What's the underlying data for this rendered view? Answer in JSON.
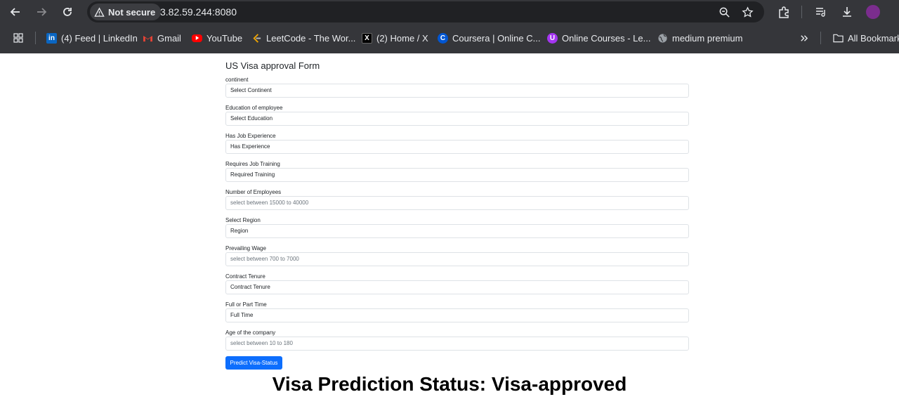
{
  "browser": {
    "security_label": "Not secure",
    "url": "3.82.59.244:8080",
    "colors": {
      "chrome_bg": "#35363a",
      "omnibox_bg": "#202124",
      "text": "#e8eaed"
    },
    "icons": [
      "back-icon",
      "forward-icon",
      "reload-icon",
      "warning-icon",
      "zoom-icon",
      "star-icon",
      "extensions-icon",
      "reading-list-icon",
      "download-icon",
      "apps-icon",
      "more-bookmarks-icon",
      "folder-icon"
    ]
  },
  "bookmarks": [
    {
      "label": "(4) Feed | LinkedIn",
      "icon": "linkedin-icon"
    },
    {
      "label": "Gmail",
      "icon": "gmail-icon"
    },
    {
      "label": "YouTube",
      "icon": "youtube-icon"
    },
    {
      "label": "LeetCode - The Wor...",
      "icon": "leetcode-icon"
    },
    {
      "label": "(2) Home / X",
      "icon": "x-icon"
    },
    {
      "label": "Coursera | Online C...",
      "icon": "coursera-icon"
    },
    {
      "label": "Online Courses - Le...",
      "icon": "udemy-icon"
    },
    {
      "label": "medium premium",
      "icon": "globe-icon"
    }
  ],
  "all_bookmarks_label": "All Bookmarks",
  "form": {
    "title": "US Visa approval Form",
    "fields": [
      {
        "label": "continent",
        "value": "Select Continent",
        "placeholder": false
      },
      {
        "label": "Education of employee",
        "value": "Select Education",
        "placeholder": false
      },
      {
        "label": "Has Job Experience",
        "value": "Has Experience",
        "placeholder": false
      },
      {
        "label": "Requires Job Training",
        "value": "Required Training",
        "placeholder": false
      },
      {
        "label": "Number of Employees",
        "value": "select between 15000 to 40000",
        "placeholder": true
      },
      {
        "label": "Select Region",
        "value": "Region",
        "placeholder": false
      },
      {
        "label": "Prevailing Wage",
        "value": "select between 700 to 7000",
        "placeholder": true
      },
      {
        "label": "Contract Tenure",
        "value": "Contract Tenure",
        "placeholder": false
      },
      {
        "label": "Full or Part Time",
        "value": "Full Time",
        "placeholder": false
      },
      {
        "label": "Age of the company",
        "value": "select between 10 to 180",
        "placeholder": true
      }
    ],
    "submit_label": "Predict Visa-Status",
    "accent": "#0d6efd"
  },
  "result": {
    "text": "Visa Prediction Status: Visa-approved"
  }
}
